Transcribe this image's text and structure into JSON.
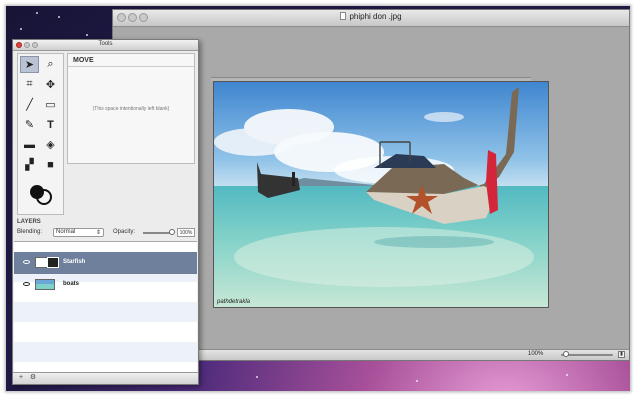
{
  "document_window": {
    "title": "phiphi don .jpg",
    "watermark": "pathdetrakla",
    "zoom_label": "100%"
  },
  "tools_panel": {
    "title": "Tools",
    "tool_options": {
      "title": "MOVE",
      "note": "(This space intentionally left blank)"
    },
    "layers": {
      "heading": "LAYERS",
      "blending_label": "Blending:",
      "blending_value": "Normal",
      "opacity_label": "Opacity:",
      "opacity_value": "100%",
      "items": [
        {
          "name": "Starfish",
          "selected": true
        },
        {
          "name": "boats",
          "selected": false
        }
      ]
    }
  },
  "icons": [
    "arrow-pointer-icon",
    "magnifier-icon",
    "crop-icon",
    "move-cross-icon",
    "brush-icon",
    "rect-select-icon",
    "pen-icon",
    "text-icon",
    "eraser-icon",
    "paint-bucket-icon",
    "gradient-icon",
    "shape-icon",
    "color-swatch-icon",
    "eye-icon",
    "add-layer-icon",
    "gear-icon"
  ],
  "colors": {
    "selected_layer": "#6f809d",
    "tool_selected": "#b9c3d3"
  }
}
